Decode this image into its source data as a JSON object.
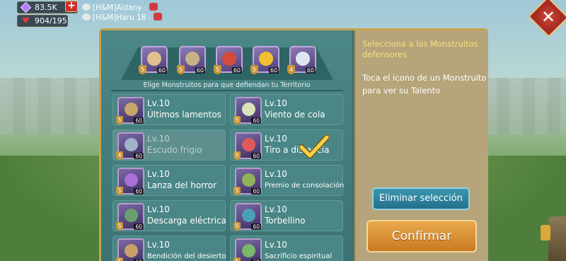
{
  "hud": {
    "gems": "83.5K",
    "stamina": "904/195",
    "plus": "+",
    "chat": [
      {
        "name": "[H&M]Aidany :"
      },
      {
        "name": "[H&M]Haru 18 :"
      }
    ]
  },
  "close_label": "✕",
  "defenders": [
    {
      "level": "60",
      "star": "5",
      "color": "#e0c090"
    },
    {
      "level": "60",
      "star": "5",
      "color": "#c7b18a"
    },
    {
      "level": "60",
      "star": "5",
      "color": "#d44a3b"
    },
    {
      "level": "60",
      "star": "5",
      "color": "#f0c030"
    },
    {
      "level": "60",
      "star": "4",
      "color": "#dfe6f0"
    }
  ],
  "hint": "Elige Monstruitos para que defiendan tu Territorio",
  "monsters": [
    {
      "lv": "Lv.10",
      "name": "Últimos lamentos",
      "level": "60",
      "star": "5",
      "color": "#c9a46a"
    },
    {
      "lv": "Lv.10",
      "name": "Viento de cola",
      "level": "60",
      "star": "5",
      "color": "#d9e4b8"
    },
    {
      "lv": "Lv.10",
      "name": "Escudo frigio",
      "level": "60",
      "star": "4",
      "color": "#9fb3c9"
    },
    {
      "lv": "Lv.10",
      "name": "Tiro a distancia",
      "level": "60",
      "star": "5",
      "color": "#e05a5a"
    },
    {
      "lv": "Lv.10",
      "name": "Lanza del horror",
      "level": "60",
      "star": "5",
      "color": "#a870d8"
    },
    {
      "lv": "Lv.10",
      "name": "Premio de consolación",
      "level": "60",
      "star": "5",
      "color": "#8fb35a"
    },
    {
      "lv": "Lv.10",
      "name": "Descarga eléctrica",
      "level": "60",
      "star": "5",
      "color": "#6aa070"
    },
    {
      "lv": "Lv.10",
      "name": "Torbellino",
      "level": "60",
      "star": "5",
      "color": "#4aa0b8"
    },
    {
      "lv": "Lv.10",
      "name": "Bendición del desierto",
      "level": "60",
      "star": "5",
      "color": "#c9a06a"
    },
    {
      "lv": "Lv.10",
      "name": "Sacrificio espiritual",
      "level": "60",
      "star": "5",
      "color": "#7ab86a"
    }
  ],
  "right_panel": {
    "title": "Selecciona a los Monstruitos defensores",
    "instructions": "Toca el icono de un Monstruito para ver su Talento",
    "clear_button": "Eliminar selección",
    "confirm_button": "Confirmar"
  }
}
